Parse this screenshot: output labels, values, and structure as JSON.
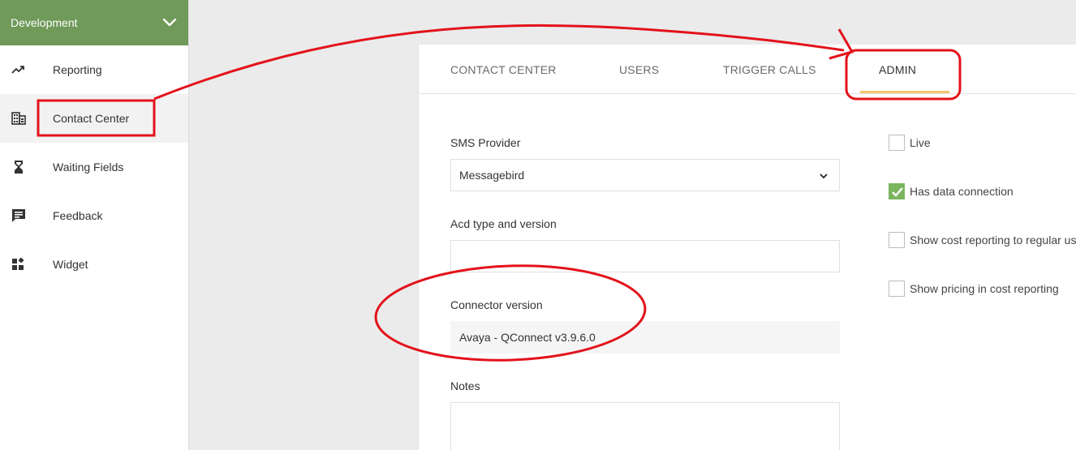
{
  "sidebar": {
    "environment": "Development",
    "items": [
      {
        "label": "Reporting",
        "icon": "trending-up-icon"
      },
      {
        "label": "Contact Center",
        "icon": "building-icon"
      },
      {
        "label": "Waiting Fields",
        "icon": "hourglass-icon"
      },
      {
        "label": "Feedback",
        "icon": "feedback-icon"
      },
      {
        "label": "Widget",
        "icon": "widget-icon"
      }
    ],
    "active_index": 1
  },
  "tabs": [
    {
      "label": "CONTACT CENTER"
    },
    {
      "label": "USERS"
    },
    {
      "label": "TRIGGER CALLS"
    },
    {
      "label": "ADMIN"
    }
  ],
  "active_tab_index": 3,
  "form": {
    "sms_provider_label": "SMS Provider",
    "sms_provider_value": "Messagebird",
    "acd_label": "Acd type and version",
    "acd_value": "",
    "connector_label": "Connector version",
    "connector_value": "Avaya - QConnect v3.9.6.0",
    "notes_label": "Notes",
    "notes_value": ""
  },
  "checkboxes": [
    {
      "label": "Live",
      "checked": false
    },
    {
      "label": "Has data connection",
      "checked": true
    },
    {
      "label": "Show cost reporting to regular us",
      "checked": false
    },
    {
      "label": "Show pricing in cost reporting",
      "checked": false
    }
  ],
  "colors": {
    "header_green": "#6f9a59",
    "check_green": "#7bb560",
    "tab_underline": "#f3c56d",
    "annotation_red": "#e3121b"
  }
}
